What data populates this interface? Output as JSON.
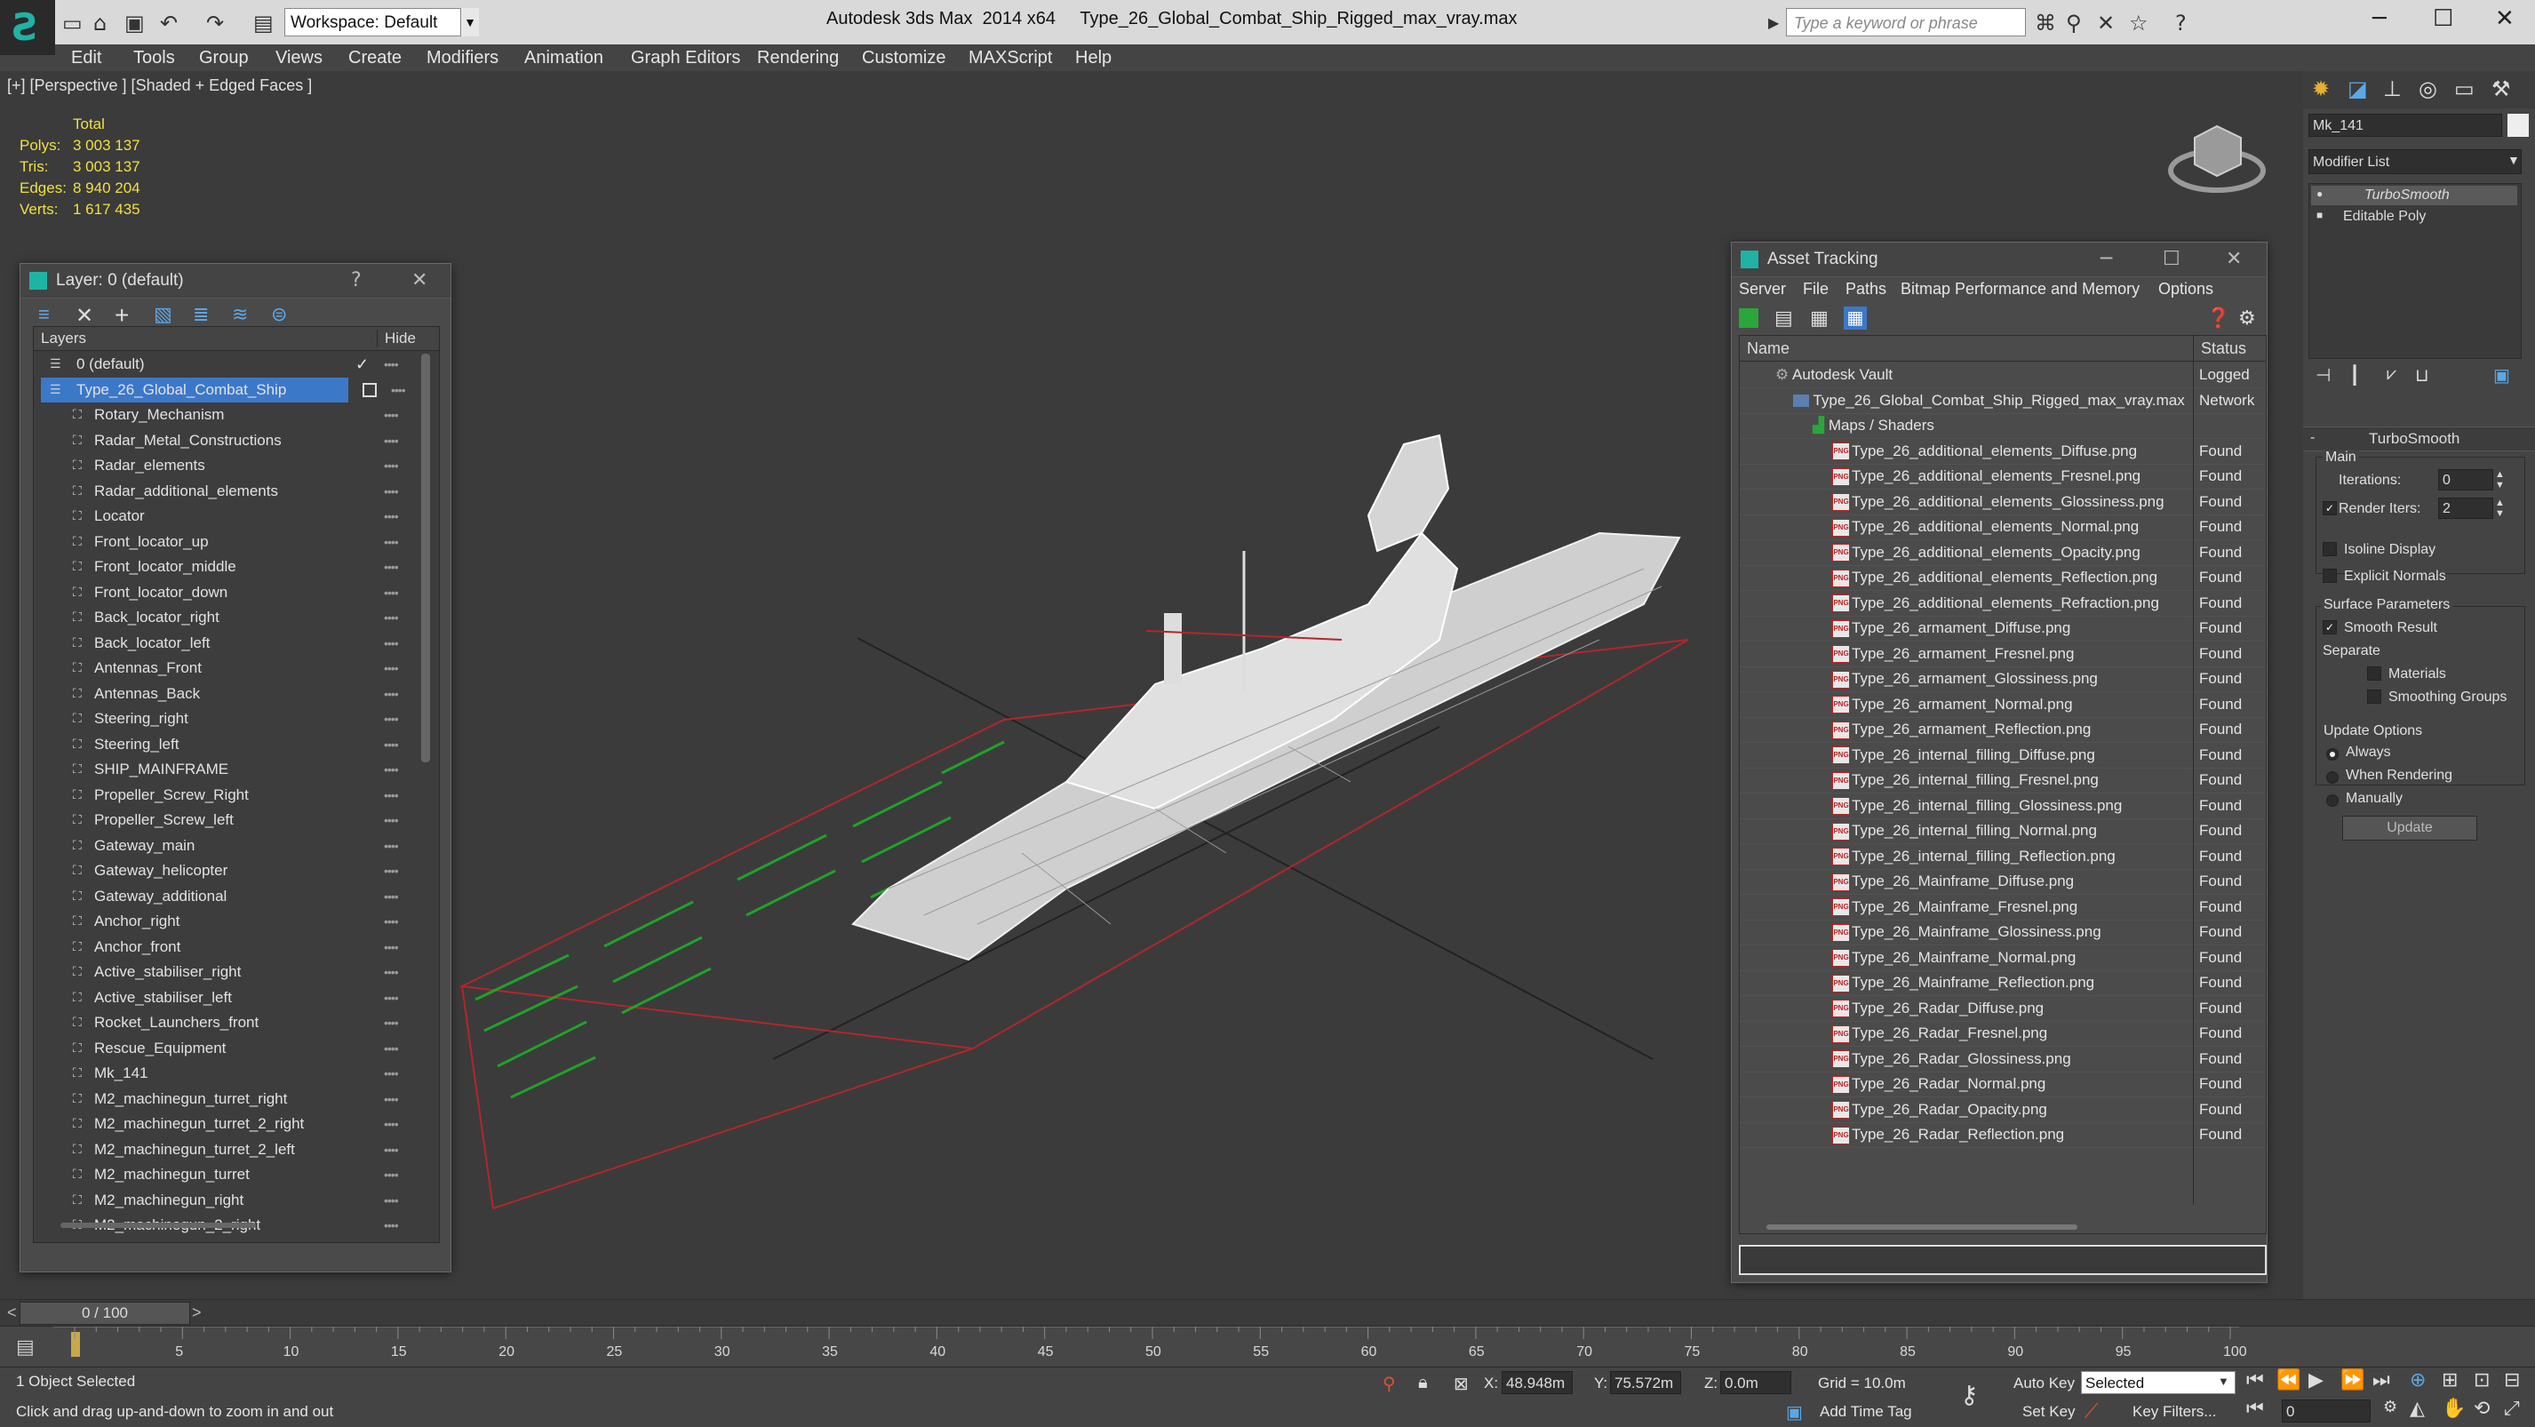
{
  "title_bar": {
    "workspace_label": "Workspace: Default",
    "app_title": "Autodesk 3ds Max  2014 x64",
    "file_title": "Type_26_Global_Combat_Ship_Rigged_max_vray.max",
    "search_placeholder": "Type a keyword or phrase"
  },
  "menu": [
    "Edit",
    "Tools",
    "Group",
    "Views",
    "Create",
    "Modifiers",
    "Animation",
    "Graph Editors",
    "Rendering",
    "Customize",
    "MAXScript",
    "Help"
  ],
  "viewport": {
    "label": "[+] [Perspective ] [Shaded + Edged Faces ]",
    "stats": {
      "header": "Total",
      "rows": [
        {
          "label": "Polys:",
          "value": "3 003 137"
        },
        {
          "label": "Tris:",
          "value": "3 003 137"
        },
        {
          "label": "Edges:",
          "value": "8 940 204"
        },
        {
          "label": "Verts:",
          "value": "1 617 435"
        }
      ]
    }
  },
  "layer_panel": {
    "title": "Layer: 0 (default)",
    "help": "?",
    "col_layers": "Layers",
    "col_hide": "Hide",
    "layers": [
      {
        "name": "0 (default)"
      },
      {
        "name": "Type_26_Global_Combat_Ship"
      },
      {
        "name": "Rotary_Mechanism"
      },
      {
        "name": "Radar_Metal_Constructions"
      },
      {
        "name": "Radar_elements"
      },
      {
        "name": "Radar_additional_elements"
      },
      {
        "name": "Locator"
      },
      {
        "name": "Front_locator_up"
      },
      {
        "name": "Front_locator_middle"
      },
      {
        "name": "Front_locator_down"
      },
      {
        "name": "Back_locator_right"
      },
      {
        "name": "Back_locator_left"
      },
      {
        "name": "Antennas_Front"
      },
      {
        "name": "Antennas_Back"
      },
      {
        "name": "Steering_right"
      },
      {
        "name": "Steering_left"
      },
      {
        "name": "SHIP_MAINFRAME"
      },
      {
        "name": "Propeller_Screw_Right"
      },
      {
        "name": "Propeller_Screw_left"
      },
      {
        "name": "Gateway_main"
      },
      {
        "name": "Gateway_helicopter"
      },
      {
        "name": "Gateway_additional"
      },
      {
        "name": "Anchor_right"
      },
      {
        "name": "Anchor_front"
      },
      {
        "name": "Active_stabiliser_right"
      },
      {
        "name": "Active_stabiliser_left"
      },
      {
        "name": "Rocket_Launchers_front"
      },
      {
        "name": "Rescue_Equipment"
      },
      {
        "name": "Mk_141"
      },
      {
        "name": "M2_machinegun_turret_right"
      },
      {
        "name": "M2_machinegun_turret_2_right"
      },
      {
        "name": "M2_machinegun_turret_2_left"
      },
      {
        "name": "M2_machinegun_turret"
      },
      {
        "name": "M2_machinegun_right"
      },
      {
        "name": "M2_machinegun_2_right"
      }
    ]
  },
  "asset_panel": {
    "title": "Asset Tracking",
    "menu": [
      "Server",
      "File",
      "Paths",
      "Bitmap Performance and Memory",
      "Options"
    ],
    "col_name": "Name",
    "col_status": "Status",
    "rows": [
      {
        "name": "Autodesk Vault",
        "status": "Logged"
      },
      {
        "name": "Type_26_Global_Combat_Ship_Rigged_max_vray.max",
        "status": "Network"
      },
      {
        "name": "Maps / Shaders",
        "status": ""
      },
      {
        "name": "Type_26_additional_elements_Diffuse.png",
        "status": "Found"
      },
      {
        "name": "Type_26_additional_elements_Fresnel.png",
        "status": "Found"
      },
      {
        "name": "Type_26_additional_elements_Glossiness.png",
        "status": "Found"
      },
      {
        "name": "Type_26_additional_elements_Normal.png",
        "status": "Found"
      },
      {
        "name": "Type_26_additional_elements_Opacity.png",
        "status": "Found"
      },
      {
        "name": "Type_26_additional_elements_Reflection.png",
        "status": "Found"
      },
      {
        "name": "Type_26_additional_elements_Refraction.png",
        "status": "Found"
      },
      {
        "name": "Type_26_armament_Diffuse.png",
        "status": "Found"
      },
      {
        "name": "Type_26_armament_Fresnel.png",
        "status": "Found"
      },
      {
        "name": "Type_26_armament_Glossiness.png",
        "status": "Found"
      },
      {
        "name": "Type_26_armament_Normal.png",
        "status": "Found"
      },
      {
        "name": "Type_26_armament_Reflection.png",
        "status": "Found"
      },
      {
        "name": "Type_26_internal_filling_Diffuse.png",
        "status": "Found"
      },
      {
        "name": "Type_26_internal_filling_Fresnel.png",
        "status": "Found"
      },
      {
        "name": "Type_26_internal_filling_Glossiness.png",
        "status": "Found"
      },
      {
        "name": "Type_26_internal_filling_Normal.png",
        "status": "Found"
      },
      {
        "name": "Type_26_internal_filling_Reflection.png",
        "status": "Found"
      },
      {
        "name": "Type_26_Mainframe_Diffuse.png",
        "status": "Found"
      },
      {
        "name": "Type_26_Mainframe_Fresnel.png",
        "status": "Found"
      },
      {
        "name": "Type_26_Mainframe_Glossiness.png",
        "status": "Found"
      },
      {
        "name": "Type_26_Mainframe_Normal.png",
        "status": "Found"
      },
      {
        "name": "Type_26_Mainframe_Reflection.png",
        "status": "Found"
      },
      {
        "name": "Type_26_Radar_Diffuse.png",
        "status": "Found"
      },
      {
        "name": "Type_26_Radar_Fresnel.png",
        "status": "Found"
      },
      {
        "name": "Type_26_Radar_Glossiness.png",
        "status": "Found"
      },
      {
        "name": "Type_26_Radar_Normal.png",
        "status": "Found"
      },
      {
        "name": "Type_26_Radar_Opacity.png",
        "status": "Found"
      },
      {
        "name": "Type_26_Radar_Reflection.png",
        "status": "Found"
      }
    ]
  },
  "command_panel": {
    "object_name": "Mk_141",
    "modifier_list": "Modifier List",
    "stack": [
      "TurboSmooth",
      "Editable Poly"
    ],
    "rollout_title": "TurboSmooth",
    "main_label": "Main",
    "iterations_label": "Iterations:",
    "iterations_value": "0",
    "render_iters_label": "Render Iters:",
    "render_iters_value": "2",
    "isoline_label": "Isoline Display",
    "explicit_normals_label": "Explicit Normals",
    "surface_params_label": "Surface Parameters",
    "smooth_result_label": "Smooth Result",
    "separate_label": "Separate",
    "materials_label": "Materials",
    "smoothing_groups_label": "Smoothing Groups",
    "update_options_label": "Update Options",
    "always_label": "Always",
    "when_rendering_label": "When Rendering",
    "manually_label": "Manually",
    "update_button": "Update"
  },
  "timeline": {
    "frame_readout": "0 / 100",
    "ticks": [
      "5",
      "10",
      "15",
      "20",
      "25",
      "30",
      "35",
      "40",
      "45",
      "50",
      "55",
      "60",
      "65",
      "70",
      "75",
      "80",
      "85",
      "90",
      "95",
      "100"
    ]
  },
  "status_bar": {
    "selection": "1 Object Selected",
    "prompt": "Click and drag up-and-down to zoom in and out",
    "x_label": "X:",
    "x_value": "48.948m",
    "y_label": "Y:",
    "y_value": "75.572m",
    "z_label": "Z:",
    "z_value": "0.0m",
    "grid": "Grid = 10.0m",
    "add_time_tag": "Add Time Tag",
    "auto_key": "Auto Key",
    "set_key": "Set Key",
    "selected_dropdown": "Selected",
    "key_filters": "Key Filters...",
    "frame_field": "0"
  }
}
